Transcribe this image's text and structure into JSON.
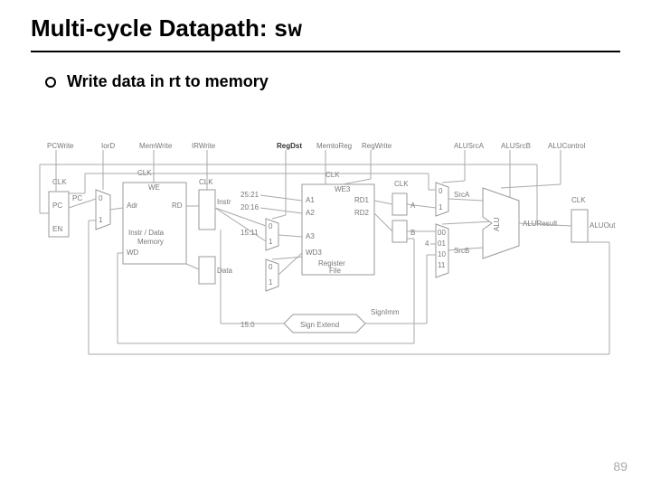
{
  "title": {
    "prefix": "Multi-cycle Datapath: ",
    "mono": "sw"
  },
  "bullet": "Write data in rt to memory",
  "page_number": "89",
  "signals": {
    "top": [
      "PCWrite",
      "IorD",
      "MemWrite",
      "IRWrite",
      "RegDst",
      "MemtoReg",
      "RegWrite",
      "ALUSrcA",
      "ALUSrcB",
      "ALUControl"
    ],
    "bold": "RegDst",
    "clk": "CLK"
  },
  "blocks": {
    "pc_reg": "PC",
    "pc_en": "EN",
    "mem": {
      "name": "Instr / Data\nMemory",
      "adr": "Adr",
      "rd": "RD",
      "wd": "WD",
      "we": "WE"
    },
    "ir": "Instr",
    "data_reg": "Data",
    "regfile": {
      "name": "Register\nFile",
      "a1": "A1",
      "a2": "A2",
      "a3": "A3",
      "wd3": "WD3",
      "we3": "WE3",
      "rd1": "RD1",
      "rd2": "RD2"
    },
    "signext": "Sign Extend",
    "signimm": "SignImm",
    "ab": {
      "a": "A",
      "b": "B"
    },
    "srcA": "SrcA",
    "srcB": "SrcB",
    "alu": "ALU",
    "aluResult": "ALUResult",
    "aluOut": "ALUOut",
    "muxB": [
      "00",
      "01",
      "10",
      "11"
    ],
    "const4": "4",
    "bitfield_rs": "25:21",
    "bitfield_rt": "20:16",
    "bitfield_rd": "15:11",
    "bitfield_imm": "15:0",
    "mux01a": [
      "0",
      "1"
    ],
    "mux01b": [
      "0",
      "1"
    ]
  }
}
